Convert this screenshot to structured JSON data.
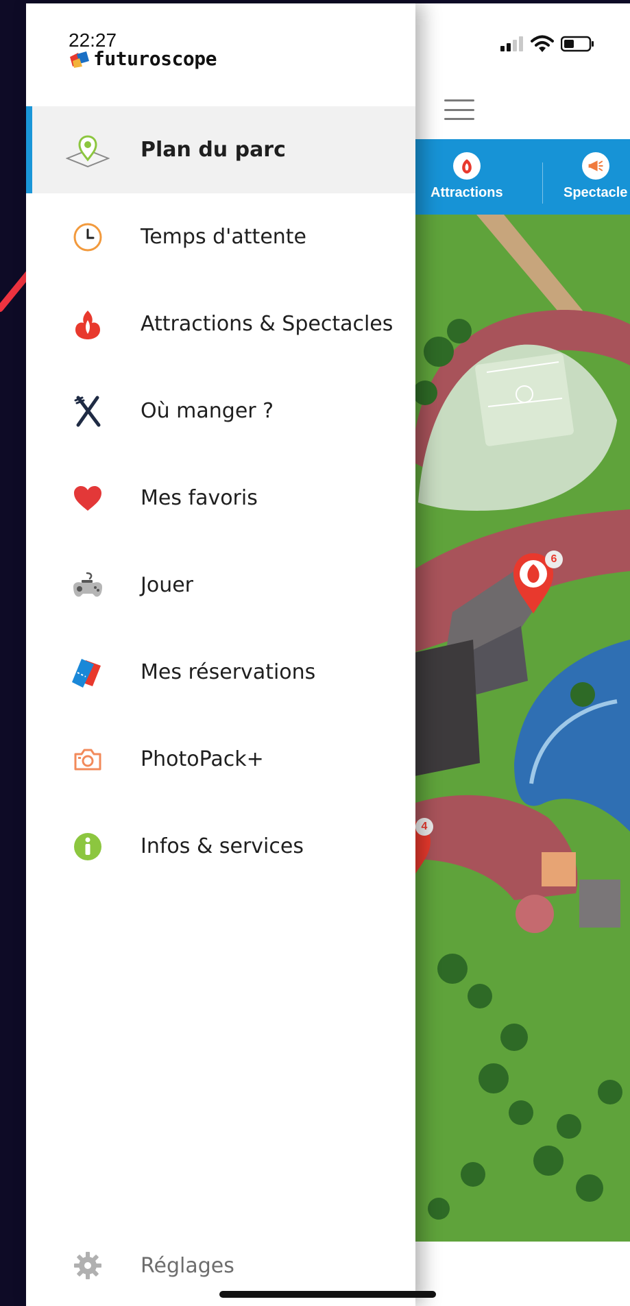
{
  "status_bar": {
    "time": "22:27"
  },
  "brand": {
    "name": "futuroscope"
  },
  "menu": {
    "items": [
      {
        "label": "Plan du parc",
        "icon": "map-pin-icon",
        "active": true
      },
      {
        "label": "Temps d'attente",
        "icon": "clock-icon",
        "active": false
      },
      {
        "label": "Attractions & Spectacles",
        "icon": "attractions-icon",
        "active": false
      },
      {
        "label": "Où manger ?",
        "icon": "fork-knife-icon",
        "active": false
      },
      {
        "label": "Mes favoris",
        "icon": "heart-icon",
        "active": false
      },
      {
        "label": "Jouer",
        "icon": "gamepad-icon",
        "active": false
      },
      {
        "label": "Mes réservations",
        "icon": "ticket-icon",
        "active": false
      },
      {
        "label": "PhotoPack+",
        "icon": "camera-icon",
        "active": false
      },
      {
        "label": "Infos & services",
        "icon": "info-icon",
        "active": false
      }
    ],
    "settings": {
      "label": "Réglages",
      "icon": "gear-icon"
    }
  },
  "categories": [
    {
      "label": "Attractions",
      "icon": "attractions-icon"
    },
    {
      "label": "Spectacle",
      "icon": "megaphone-icon"
    }
  ],
  "map": {
    "markers": [
      {
        "count": "6",
        "icon": "attractions-icon"
      },
      {
        "count": "4",
        "icon": "attractions-icon"
      }
    ]
  },
  "colors": {
    "accent_blue": "#1a96d8",
    "category_bar": "#1793d6",
    "marker_red": "#e8392d",
    "heart_red": "#e33838",
    "info_green": "#8cc63f",
    "map_grass": "#5fa33b",
    "map_path": "#a8535a",
    "map_water": "#2f6fb3"
  }
}
